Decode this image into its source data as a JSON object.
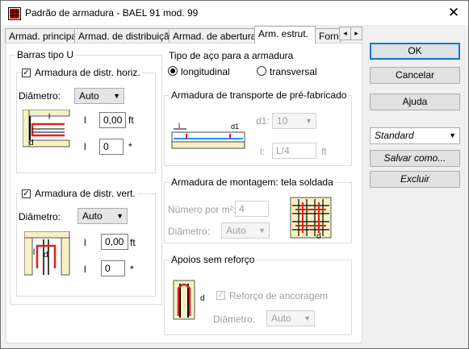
{
  "window": {
    "title": "Padrão de armadura - BAEL 91 mod. 99",
    "close_glyph": "✕"
  },
  "tabs": [
    {
      "label": "Armad. principal"
    },
    {
      "label": "Armad. de distribuição"
    },
    {
      "label": "Armad. de abertura"
    },
    {
      "label": "Arm. estrut."
    },
    {
      "label": "Forn"
    }
  ],
  "tab_scroll": {
    "left": "◂",
    "right": "▸"
  },
  "barras_u": {
    "title": "Barras tipo U",
    "horiz": {
      "check": "✓",
      "label": "Armadura de distr. horiz.",
      "diam_label": "Diâmetro:",
      "diam_value": "Auto",
      "l_label": "l",
      "l_value": "0,00",
      "l_unit": "ft",
      "n_label": "l",
      "n_value": "0",
      "n_unit": "*",
      "fig_letter_l": "l",
      "fig_letter_d": "d"
    },
    "vert": {
      "check": "✓",
      "label": "Armadura de distr. vert.",
      "diam_label": "Diâmetro:",
      "diam_value": "Auto",
      "l_label": "l",
      "l_value": "0,00",
      "l_unit": "ft",
      "n_label": "l",
      "n_value": "0",
      "n_unit": "*",
      "fig_letter_l": "l",
      "fig_letter_d": "d"
    }
  },
  "tipo_aco": {
    "title": "Tipo de aço para a armadura",
    "options": [
      {
        "label": "longitudinal",
        "selected": true
      },
      {
        "label": "transversal",
        "selected": false
      }
    ]
  },
  "transporte": {
    "title": "Armadura de transporte de pré-fabricado",
    "d1_label": "d1:",
    "d1_value": "10",
    "l_label": "l:",
    "l_value": "L/4",
    "l_unit": "ft",
    "fig_letter_l": "l",
    "fig_letter_d1": "d1"
  },
  "montagem": {
    "title": "Armadura de montagem: tela soldada",
    "numero_label": "Número por m²:",
    "numero_value": "4",
    "diam_label": "Diâmetro:",
    "diam_value": "Auto",
    "fig_letter_d": "d"
  },
  "apoios": {
    "title": "Apoios sem reforço",
    "check": "✓",
    "reforco_label": "Reforço de ancoragem",
    "diam_label": "Diâmetro:",
    "diam_value": "Auto",
    "fig_letter_d": "d"
  },
  "buttons": {
    "ok": "OK",
    "cancel": "Cancelar",
    "help": "Ajuda",
    "preset_value": "Standard",
    "save_as": "Salvar como...",
    "delete": "Excluir"
  },
  "colors": {
    "rebar_red": "#e02020",
    "beam_blue": "#1e90ff",
    "concrete": "#f6f1c4"
  }
}
